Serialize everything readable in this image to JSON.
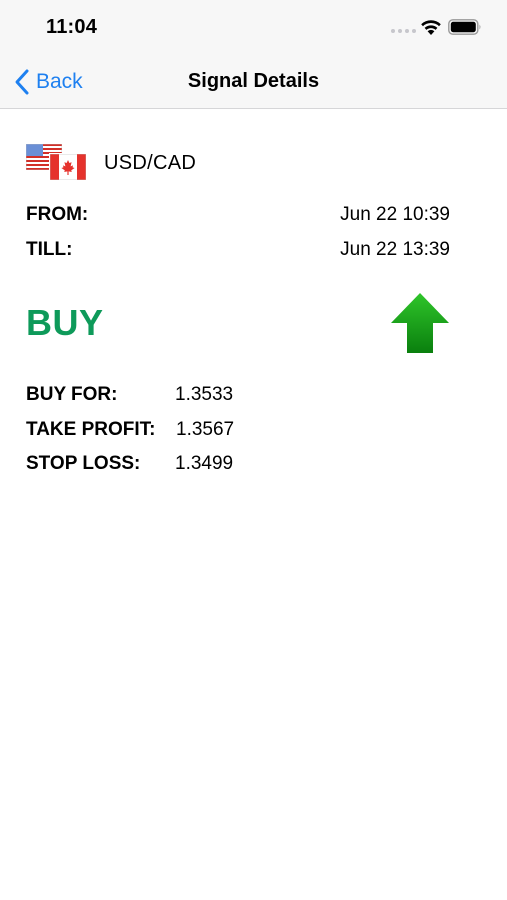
{
  "status_bar": {
    "time": "11:04",
    "icons": [
      "signal-dots-icon",
      "wifi-icon",
      "battery-icon"
    ]
  },
  "nav": {
    "back_label": "Back",
    "title": "Signal Details",
    "accent_color": "#1e80f0"
  },
  "signal": {
    "pair": "USD/CAD",
    "flags": [
      "us-flag-icon",
      "canada-flag-icon"
    ],
    "from_label": "FROM:",
    "from_value": "Jun 22 10:39",
    "till_label": "TILL:",
    "till_value": "Jun 22 13:39",
    "direction": "BUY",
    "direction_color": "#0e9a5a",
    "direction_icon": "up-arrow-icon",
    "buy_for_label": "BUY FOR:",
    "buy_for_value": "1.3533",
    "take_profit_label": "TAKE PROFIT:",
    "take_profit_value": "1.3567",
    "stop_loss_label": "STOP LOSS:",
    "stop_loss_value": "1.3499"
  }
}
